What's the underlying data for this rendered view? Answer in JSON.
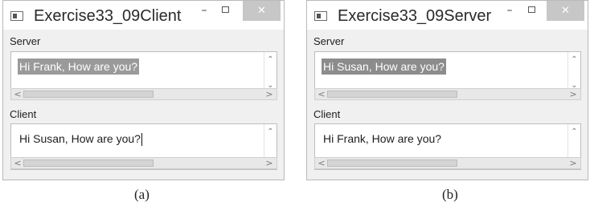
{
  "windows": [
    {
      "title": "Exercise33_09Client",
      "server_label": "Server",
      "server_text": "Hi Frank, How are you?",
      "client_label": "Client",
      "client_text": "Hi Susan, How are you?",
      "caption": "(a)"
    },
    {
      "title": "Exercise33_09Server",
      "server_label": "Server",
      "server_text": "Hi Susan, How are you?",
      "client_label": "Client",
      "client_text": "Hi Frank, How are you?",
      "caption": "(b)"
    }
  ],
  "controls": {
    "minimize": "–",
    "close": "✕"
  },
  "scroll": {
    "up": "⌃",
    "down": "⌄",
    "left": "<",
    "right": ">"
  },
  "colors": {
    "window_bg": "#f0f0f0",
    "close_button": "#c7c7c7",
    "selection": "#9a9a9a"
  }
}
